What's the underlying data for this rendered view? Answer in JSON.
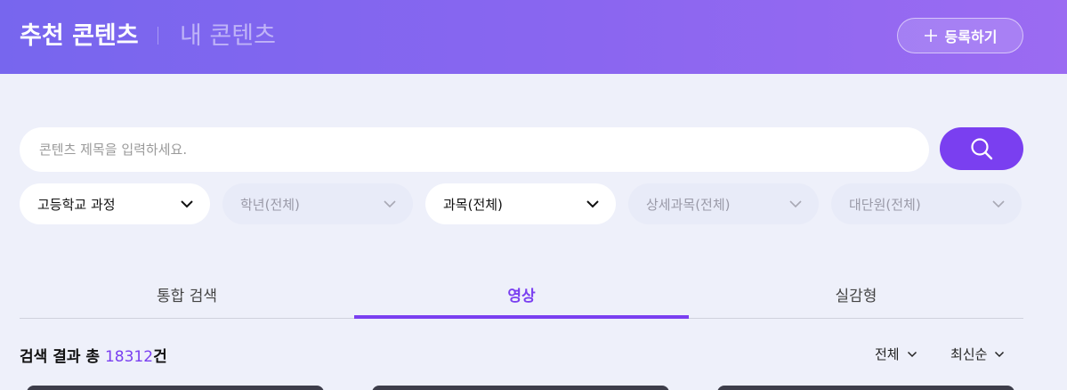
{
  "header": {
    "active_tab": "추천 콘텐츠",
    "tab": "내 콘텐츠",
    "register_label": "등록하기"
  },
  "search": {
    "placeholder": "콘텐츠 제목을 입력하세요."
  },
  "filters": [
    {
      "label": "고등학교 과정",
      "active": true
    },
    {
      "label": "학년(전체)",
      "active": false
    },
    {
      "label": "과목(전체)",
      "active": true
    },
    {
      "label": "상세과목(전체)",
      "active": false
    },
    {
      "label": "대단원(전체)",
      "active": false
    }
  ],
  "tabs": [
    {
      "label": "통합 검색"
    },
    {
      "label": "영상"
    },
    {
      "label": "실감형"
    }
  ],
  "results": {
    "prefix": "검색 결과 총 ",
    "count": "18312",
    "suffix": "건"
  },
  "sort": {
    "type": "전체",
    "order": "최신순"
  },
  "colors": {
    "accent": "#7a3ff0",
    "header_start": "#7766ee",
    "header_end": "#9b6bf2"
  }
}
